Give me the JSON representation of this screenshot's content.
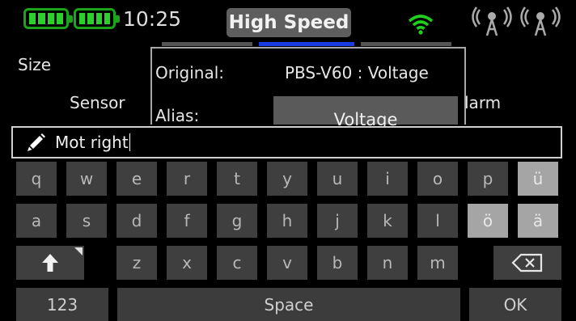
{
  "status": {
    "time": "10:25",
    "mode": "High Speed",
    "colors": {
      "battery": "#2bd12b",
      "wifi": "#1fd11f",
      "badge": "#5e5e5e"
    }
  },
  "background": {
    "size_label": "Size",
    "sensor_label": "Sensor",
    "alarm_label": "larm"
  },
  "dialog": {
    "original_label": "Original:",
    "original_value": "PBS-V60 : Voltage",
    "alias_label": "Alias:",
    "alias_value": "Voltage"
  },
  "input": {
    "value": "Mot right"
  },
  "keyboard": {
    "row1": [
      "q",
      "w",
      "e",
      "r",
      "t",
      "y",
      "u",
      "i",
      "o",
      "p",
      "ü"
    ],
    "row2": [
      "a",
      "s",
      "d",
      "f",
      "g",
      "h",
      "j",
      "k",
      "l",
      "ö",
      "ä"
    ],
    "row3": [
      "z",
      "x",
      "c",
      "v",
      "b",
      "n",
      "m"
    ],
    "shift_icon": "up-arrow-icon",
    "backspace_icon": "backspace-icon",
    "numbers_label": "123",
    "space_label": "Space",
    "ok_label": "OK"
  }
}
